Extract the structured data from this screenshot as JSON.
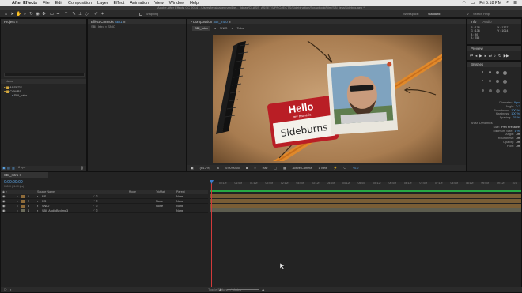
{
  "menubar": {
    "apple": "",
    "app": "After Effects",
    "items": [
      "File",
      "Edit",
      "Composition",
      "Layer",
      "Effect",
      "Animation",
      "View",
      "Window",
      "Help"
    ],
    "time": "Fri 5:18 PM",
    "search_icon": "search-icon"
  },
  "titlebar": {
    "text": "Adobe After Effects CC 2014 - /Users/jessicahennan/De..._Ideas/CLASS_ASSETS/PROJECTS/Sidebination/ScrapbookFilm/SBI_jessSidebns.aep *"
  },
  "toolbar": {
    "snapping": "Snapping",
    "workspace_label": "Workspace:",
    "workspace": "Standard",
    "search": "Search Help"
  },
  "project": {
    "tab": "Project",
    "search_placeholder": "",
    "col_name": "Name",
    "items": [
      "ASSETS",
      "COMPS",
      "SBI_Intro"
    ],
    "footer": "8 bpc"
  },
  "effects": {
    "tab": "Effect Controls",
    "tab_target": "SBI1",
    "subtitle": "SBI_Intro × SNIO"
  },
  "composition": {
    "tab": "Composition",
    "tab_target": "SBI_Intro",
    "crumbs": [
      "SBI_Intro",
      "SNIO",
      "Tabs"
    ],
    "zoom": "(64.2%)",
    "timecode": "0:00:00:00",
    "quality": "Half",
    "camera": "Active Camera",
    "views": "1 View",
    "exposure": "+0.0"
  },
  "nametag": {
    "hello": "Hello",
    "my_name": "my name is",
    "name": "Sideburns"
  },
  "info": {
    "tab_info": "Info",
    "tab_audio": "Audio",
    "r": "R : 178",
    "g": "G : 136",
    "b": "B : 89",
    "a": "A : 255",
    "x": "X : 1327",
    "y": "Y : 1014"
  },
  "preview": {
    "tab": "Preview"
  },
  "brushes": {
    "tab": "Brushes",
    "labels": [
      "Diameter:",
      "Angle:",
      "Roundness:",
      "Hardness:",
      "Spacing:"
    ],
    "values": [
      "9 px",
      "0 °",
      "100 %",
      "100 %",
      "25 %"
    ],
    "dynamics": "Brush Dynamics",
    "props": [
      [
        "Size:",
        "Pen Pressure"
      ],
      [
        "Minimum Size:",
        "1 %"
      ],
      [
        "Angle:",
        "Off"
      ],
      [
        "Roundness:",
        "Off"
      ],
      [
        "Opacity:",
        "Off"
      ],
      [
        "Flow:",
        "Off"
      ]
    ]
  },
  "timeline": {
    "tab": "SBI_Intro",
    "timecode": "0:00:00:00",
    "frame_info": "00000 (24.00 fps)",
    "col_source": "Source Name",
    "col_mode": "Mode",
    "col_trkmat": "TrkMat",
    "col_parent": "Parent",
    "layers": [
      {
        "num": "1",
        "name": "RS",
        "mode": "",
        "trk": "",
        "parent": "None",
        "color": "#8e6b3a"
      },
      {
        "num": "2",
        "name": "RS",
        "mode": "",
        "trk": "None",
        "parent": "None",
        "color": "#8e6b3a"
      },
      {
        "num": "3",
        "name": "SNIO",
        "mode": "",
        "trk": "None",
        "parent": "None",
        "color": "#8e6b3a"
      },
      {
        "num": "4",
        "name": "SBI_AudioBed.mp3",
        "mode": "",
        "trk": "",
        "parent": "None",
        "color": "#6b6b5a"
      }
    ],
    "ticks": [
      "00:12f",
      "01:00f",
      "01:12f",
      "02:00f",
      "02:12f",
      "03:00f",
      "03:12f",
      "04:00f",
      "04:12f",
      "05:00f",
      "05:12f",
      "06:00f",
      "06:12f",
      "07:00f",
      "07:12f",
      "08:00f",
      "08:12f",
      "09:00f",
      "09:12f",
      "10:0"
    ],
    "footer": "Toggle Switches / Modes"
  },
  "colors": {
    "accent": "#5ba4e5",
    "playhead": "#d23a3a",
    "work_area": "#27a844"
  }
}
